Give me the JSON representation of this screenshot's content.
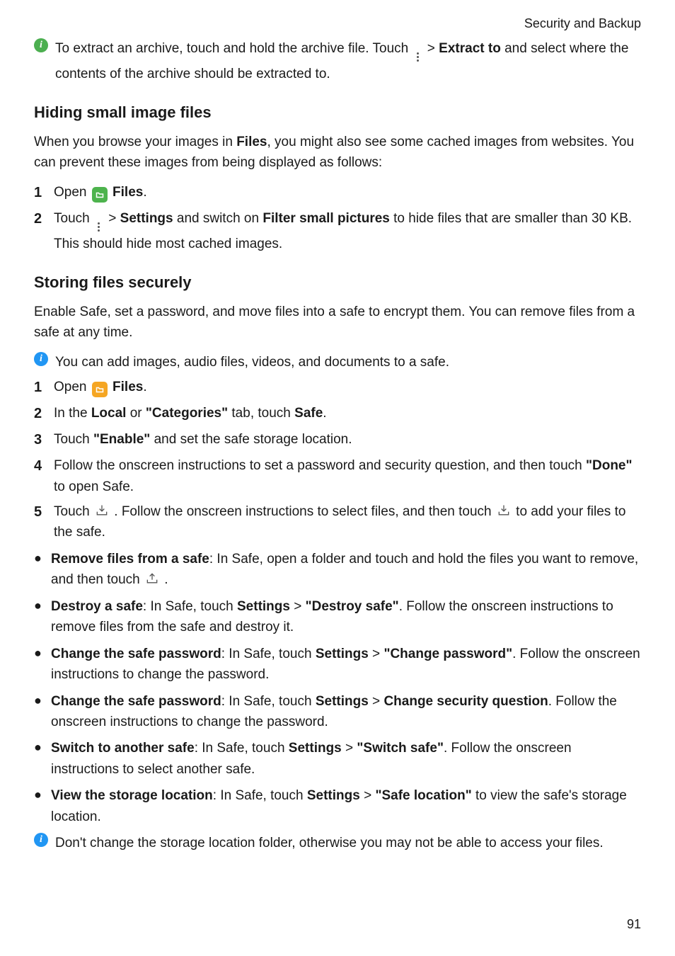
{
  "header": {
    "breadcrumb": "Security and Backup"
  },
  "footer": {
    "page_number": "91"
  },
  "tip": {
    "prefix": "To extract an archive, touch and hold the archive file. Touch ",
    "menu_gt": " > ",
    "extract_to": "Extract to",
    "suffix": " and select where the contents of the archive should be extracted to."
  },
  "section1": {
    "heading": "Hiding small image files",
    "intro_pre": "When you browse your images in ",
    "intro_files": "Files",
    "intro_post": ", you might also see some cached images from websites. You can prevent these images from being displayed as follows:",
    "step1_num": "1",
    "step1_open": "Open ",
    "step1_files": "Files",
    "step1_period": ".",
    "step2_num": "2",
    "step2_touch": "Touch ",
    "step2_gt": " > ",
    "step2_settings": "Settings",
    "step2_mid": " and switch on ",
    "step2_filter": "Filter small pictures",
    "step2_end": " to hide files that are smaller than 30 KB. This should hide most cached images."
  },
  "section2": {
    "heading": "Storing files securely",
    "intro": "Enable Safe, set a password, and move files into a safe to encrypt them. You can remove files from a safe at any time.",
    "note": "You can add images, audio files, videos, and documents to a safe.",
    "s1_num": "1",
    "s1_open": "Open ",
    "s1_files": "Files",
    "s1_period": ".",
    "s2_num": "2",
    "s2_a": "In the ",
    "s2_local": "Local",
    "s2_or": " or ",
    "s2_cat": "\"Categories\"",
    "s2_b": " tab, touch ",
    "s2_safe": "Safe",
    "s2_p": ".",
    "s3_num": "3",
    "s3_a": "Touch ",
    "s3_enable": "\"Enable\"",
    "s3_b": " and set the safe storage location.",
    "s4_num": "4",
    "s4_a": "Follow the onscreen instructions to set a password and security question, and then touch ",
    "s4_done": "\"Done\"",
    "s4_b": " to open Safe.",
    "s5_num": "5",
    "s5_a": "Touch ",
    "s5_b": " . Follow the onscreen instructions to select files, and then touch ",
    "s5_c": " to add your files to the safe."
  },
  "bullets": {
    "b1_t": "Remove files from a safe",
    "b1_a": ": In Safe, open a folder and touch and hold the files you want to remove, and then touch ",
    "b1_p": " .",
    "b2_t": "Destroy a safe",
    "b2_a": ": In Safe, touch ",
    "b2_set": "Settings",
    "b2_gt": " > ",
    "b2_act": "\"Destroy safe\"",
    "b2_b": ". Follow the onscreen instructions to remove files from the safe and destroy it.",
    "b3_t": "Change the safe password",
    "b3_a": ": In Safe, touch ",
    "b3_set": "Settings",
    "b3_gt": " > ",
    "b3_act": "\"Change password\"",
    "b3_b": ". Follow the onscreen instructions to change the password.",
    "b4_t": "Change the safe password",
    "b4_a": ": In Safe, touch ",
    "b4_set": "Settings",
    "b4_gt": " > ",
    "b4_act": "Change security question",
    "b4_b": ". Follow the onscreen instructions to change the password.",
    "b5_t": "Switch to another safe",
    "b5_a": ": In Safe, touch ",
    "b5_set": "Settings",
    "b5_gt": " > ",
    "b5_act": "\"Switch safe\"",
    "b5_b": ". Follow the onscreen instructions to select another safe.",
    "b6_t": "View the storage location",
    "b6_a": ": In Safe, touch ",
    "b6_set": "Settings",
    "b6_gt": " > ",
    "b6_act": "\"Safe location\"",
    "b6_b": " to view the safe's storage location.",
    "note": "Don't change the storage location folder, otherwise you may not be able to access your files."
  }
}
